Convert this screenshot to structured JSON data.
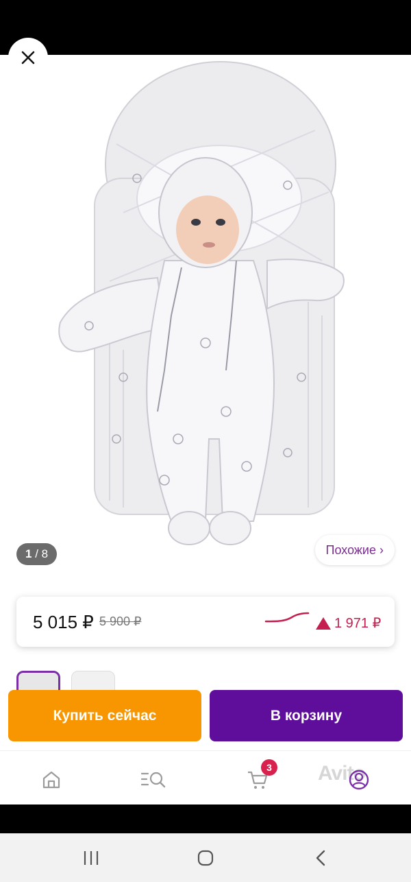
{
  "gallery": {
    "counter_current": "1",
    "counter_total": " / 8",
    "similar_label": "Похожие ›"
  },
  "price": {
    "current": "5 015 ₽",
    "old": "5 900 ₽",
    "change": "1 971 ₽",
    "change_direction": "up"
  },
  "actions": {
    "buy_now_label": "Купить сейчас",
    "to_cart_label": "В корзину"
  },
  "nav": {
    "cart_badge": "3",
    "items": [
      "home-icon",
      "search-catalog-icon",
      "cart-icon",
      "profile-icon"
    ]
  },
  "watermark": "Avito",
  "system_nav": [
    "recents-icon",
    "home-circle-icon",
    "back-icon"
  ],
  "colors": {
    "accent_purple": "#5e0e9a",
    "buy_orange": "#f79600",
    "similar_text": "#7b2d90",
    "price_up": "#c41f4e"
  }
}
